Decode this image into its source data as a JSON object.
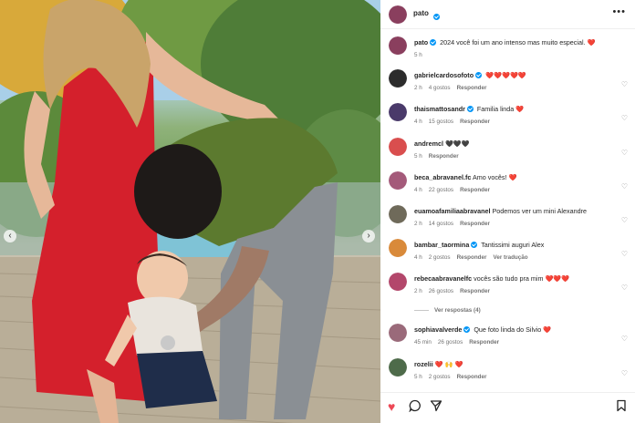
{
  "post": {
    "author": "pato",
    "verified": true,
    "caption": "2024 você foi um ano intenso mas muito especial. ❤️",
    "caption_time": "5 h",
    "avatar_color": "#8a3f5e"
  },
  "comments": [
    {
      "user": "gabrielcardosofoto",
      "verified": true,
      "text": "❤️❤️❤️❤️❤️",
      "time": "2 h",
      "likes": "4 gostos",
      "reply": "Responder",
      "avatar_color": "#2c2c2c"
    },
    {
      "user": "thaismattosandr",
      "verified": true,
      "text": "Familia linda ❤️",
      "time": "4 h",
      "likes": "15 gostos",
      "reply": "Responder",
      "avatar_color": "#4a3a6a"
    },
    {
      "user": "andremcl",
      "verified": false,
      "text": "🖤🖤🖤",
      "time": "5 h",
      "likes": "",
      "reply": "Responder",
      "avatar_color": "#d94e4e"
    },
    {
      "user": "beca_abravanel.fc",
      "verified": false,
      "text": "Amo vocês! ❤️",
      "time": "4 h",
      "likes": "22 gostos",
      "reply": "Responder",
      "avatar_color": "#a45a7a"
    },
    {
      "user": "euamoafamiliaabravanel",
      "verified": false,
      "text": "Podemos ver um mini Alexandre",
      "time": "2 h",
      "likes": "14 gostos",
      "reply": "Responder",
      "avatar_color": "#6f6a5a"
    },
    {
      "user": "bambar_taormina",
      "verified": true,
      "text": "Tantissimi auguri Alex",
      "time": "4 h",
      "likes": "2 gostos",
      "reply": "Responder",
      "translate": "Ver tradução",
      "avatar_color": "#d98a3a"
    },
    {
      "user": "rebecaabravanelfc",
      "verified": false,
      "text": "vocês são tudo pra mim ❤️❤️❤️",
      "time": "2 h",
      "likes": "26 gostos",
      "reply": "Responder",
      "avatar_color": "#b3476b"
    },
    {
      "user": "sophiavalverde",
      "verified": true,
      "text": "Que foto linda do Silvio ❤️",
      "time": "45 min",
      "likes": "26 gostos",
      "reply": "Responder",
      "avatar_color": "#9a6a7a"
    },
    {
      "user": "rozelii",
      "verified": false,
      "text": "❤️ 🙌 ❤️",
      "time": "5 h",
      "likes": "2 gostos",
      "reply": "Responder",
      "avatar_color": "#4e6b4a"
    }
  ],
  "replies_link": "Ver respostas (4)",
  "icons": {
    "more": "more-options-icon",
    "like": "heart-outline-icon",
    "liked": "heart-filled-icon",
    "comment": "comment-icon",
    "share": "share-icon",
    "save": "bookmark-icon"
  },
  "colors": {
    "accent_red": "#ed4956",
    "verified_blue": "#0095f6"
  }
}
